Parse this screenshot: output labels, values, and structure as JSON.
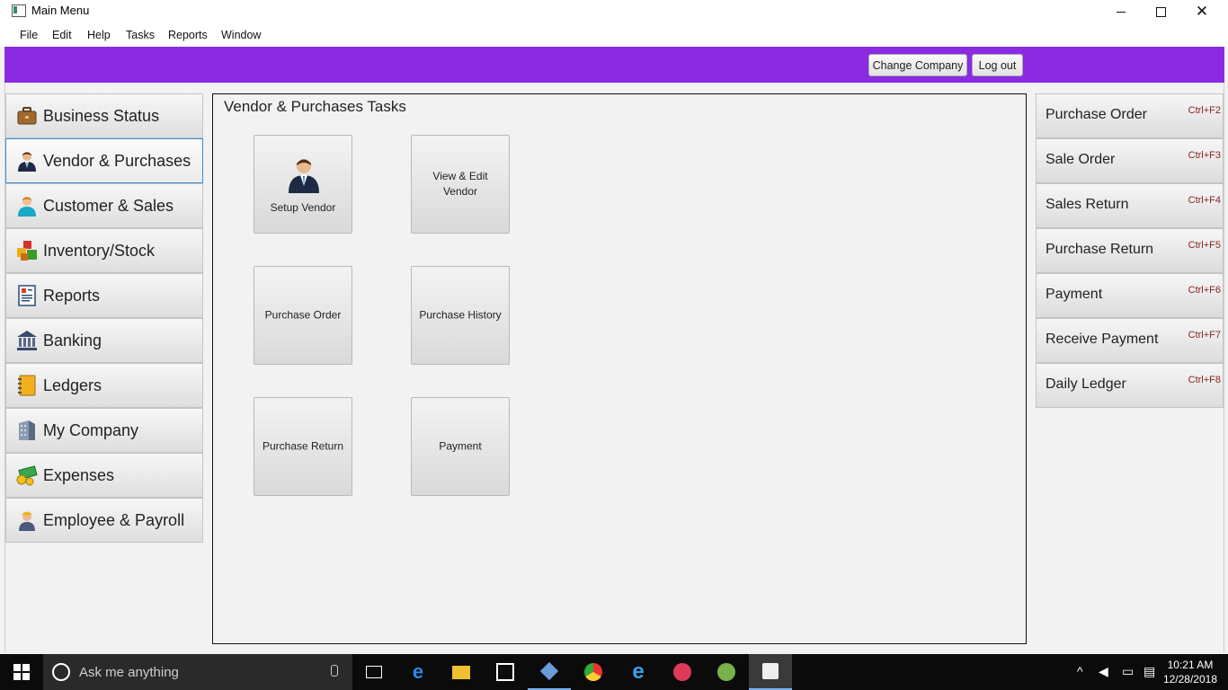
{
  "window": {
    "title": "Main Menu"
  },
  "menu": [
    "File",
    "Edit",
    "Help",
    "Tasks",
    "Reports",
    "Window"
  ],
  "header": {
    "change_company": "Change Company",
    "logout": "Log out",
    "banner_color": "#8a2be2"
  },
  "sidebar": {
    "items": [
      {
        "label": "Business Status",
        "icon": "briefcase-icon"
      },
      {
        "label": "Vendor & Purchases",
        "icon": "businessman-icon",
        "active": true
      },
      {
        "label": "Customer & Sales",
        "icon": "customer-icon"
      },
      {
        "label": "Inventory/Stock",
        "icon": "boxes-icon"
      },
      {
        "label": "Reports",
        "icon": "report-icon"
      },
      {
        "label": "Banking",
        "icon": "bank-icon"
      },
      {
        "label": "Ledgers",
        "icon": "ledger-book-icon"
      },
      {
        "label": "My Company",
        "icon": "building-icon"
      },
      {
        "label": "Expenses",
        "icon": "money-icon"
      },
      {
        "label": "Employee & Payroll",
        "icon": "worker-icon"
      }
    ]
  },
  "main": {
    "title": "Vendor & Purchases Tasks",
    "tasks": [
      {
        "label": "Setup Vendor"
      },
      {
        "label": "View & Edit Vendor"
      },
      {
        "label": "Purchase Order"
      },
      {
        "label": "Purchase History"
      },
      {
        "label": "Purchase Return"
      },
      {
        "label": "Payment"
      }
    ]
  },
  "quick": {
    "items": [
      {
        "label": "Purchase Order",
        "shortcut": "Ctrl+F2"
      },
      {
        "label": "Sale Order",
        "shortcut": "Ctrl+F3"
      },
      {
        "label": "Sales Return",
        "shortcut": "Ctrl+F4"
      },
      {
        "label": "Purchase Return",
        "shortcut": "Ctrl+F5"
      },
      {
        "label": "Payment",
        "shortcut": "Ctrl+F6"
      },
      {
        "label": "Receive Payment",
        "shortcut": "Ctrl+F7"
      },
      {
        "label": "Daily Ledger",
        "shortcut": "Ctrl+F8"
      }
    ]
  },
  "taskbar": {
    "search_placeholder": "Ask me anything",
    "time": "10:21 AM",
    "date": "12/28/2018"
  }
}
